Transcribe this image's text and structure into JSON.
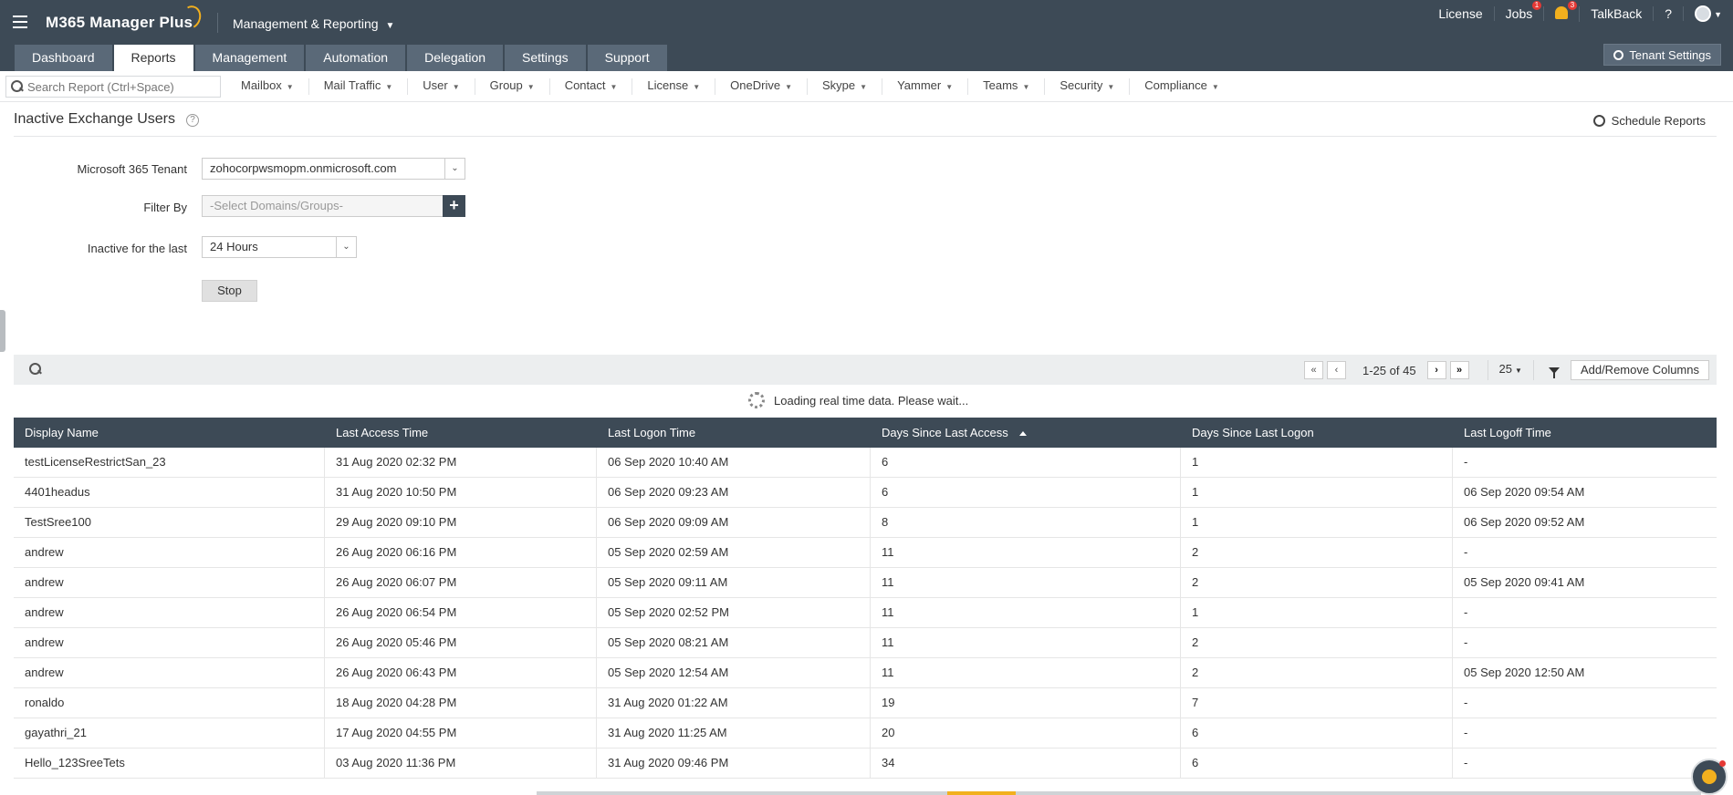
{
  "header": {
    "brand": "M365 Manager Plus",
    "module": "Management & Reporting",
    "top_links": {
      "license": "License",
      "jobs": "Jobs",
      "jobs_badge": "1",
      "notif_badge": "3",
      "talkback": "TalkBack",
      "help": "?"
    }
  },
  "tabs": [
    {
      "label": "Dashboard"
    },
    {
      "label": "Reports"
    },
    {
      "label": "Management"
    },
    {
      "label": "Automation"
    },
    {
      "label": "Delegation"
    },
    {
      "label": "Settings"
    },
    {
      "label": "Support"
    }
  ],
  "tenant_settings": "Tenant Settings",
  "search": {
    "placeholder": "Search Report (Ctrl+Space)"
  },
  "menu": [
    "Mailbox",
    "Mail Traffic",
    "User",
    "Group",
    "Contact",
    "License",
    "OneDrive",
    "Skype",
    "Yammer",
    "Teams",
    "Security",
    "Compliance"
  ],
  "page": {
    "title": "Inactive Exchange Users",
    "schedule": "Schedule Reports"
  },
  "form": {
    "tenant_label": "Microsoft 365 Tenant",
    "tenant_value": "zohocorpwsmopm.onmicrosoft.com",
    "filter_label": "Filter By",
    "filter_placeholder": "-Select Domains/Groups-",
    "inactive_label": "Inactive for the last",
    "inactive_value": "24 Hours",
    "stop": "Stop"
  },
  "grid": {
    "page_info": "1-25 of 45",
    "page_size": "25",
    "add_remove": "Add/Remove Columns",
    "loading": "Loading real time data. Please wait..."
  },
  "table": {
    "headers": [
      "Display Name",
      "Last Access Time",
      "Last Logon Time",
      "Days Since Last Access",
      "Days Since Last Logon",
      "Last Logoff Time"
    ],
    "rows": [
      [
        "testLicenseRestrictSan_23",
        "31 Aug 2020 02:32 PM",
        "06 Sep 2020 10:40 AM",
        "6",
        "1",
        "-"
      ],
      [
        "4401headus",
        "31 Aug 2020 10:50 PM",
        "06 Sep 2020 09:23 AM",
        "6",
        "1",
        "06 Sep 2020 09:54 AM"
      ],
      [
        "TestSree100",
        "29 Aug 2020 09:10 PM",
        "06 Sep 2020 09:09 AM",
        "8",
        "1",
        "06 Sep 2020 09:52 AM"
      ],
      [
        "andrew",
        "26 Aug 2020 06:16 PM",
        "05 Sep 2020 02:59 AM",
        "11",
        "2",
        "-"
      ],
      [
        "andrew",
        "26 Aug 2020 06:07 PM",
        "05 Sep 2020 09:11 AM",
        "11",
        "2",
        "05 Sep 2020 09:41 AM"
      ],
      [
        "andrew",
        "26 Aug 2020 06:54 PM",
        "05 Sep 2020 02:52 PM",
        "11",
        "1",
        "-"
      ],
      [
        "andrew",
        "26 Aug 2020 05:46 PM",
        "05 Sep 2020 08:21 AM",
        "11",
        "2",
        "-"
      ],
      [
        "andrew",
        "26 Aug 2020 06:43 PM",
        "05 Sep 2020 12:54 AM",
        "11",
        "2",
        "05 Sep 2020 12:50 AM"
      ],
      [
        "ronaldo",
        "18 Aug 2020 04:28 PM",
        "31 Aug 2020 01:22 AM",
        "19",
        "7",
        "-"
      ],
      [
        "gayathri_21",
        "17 Aug 2020 04:55 PM",
        "31 Aug 2020 11:25 AM",
        "20",
        "6",
        "-"
      ],
      [
        "Hello_123SreeTets",
        "03 Aug 2020 11:36 PM",
        "31 Aug 2020 09:46 PM",
        "34",
        "6",
        "-"
      ]
    ]
  }
}
